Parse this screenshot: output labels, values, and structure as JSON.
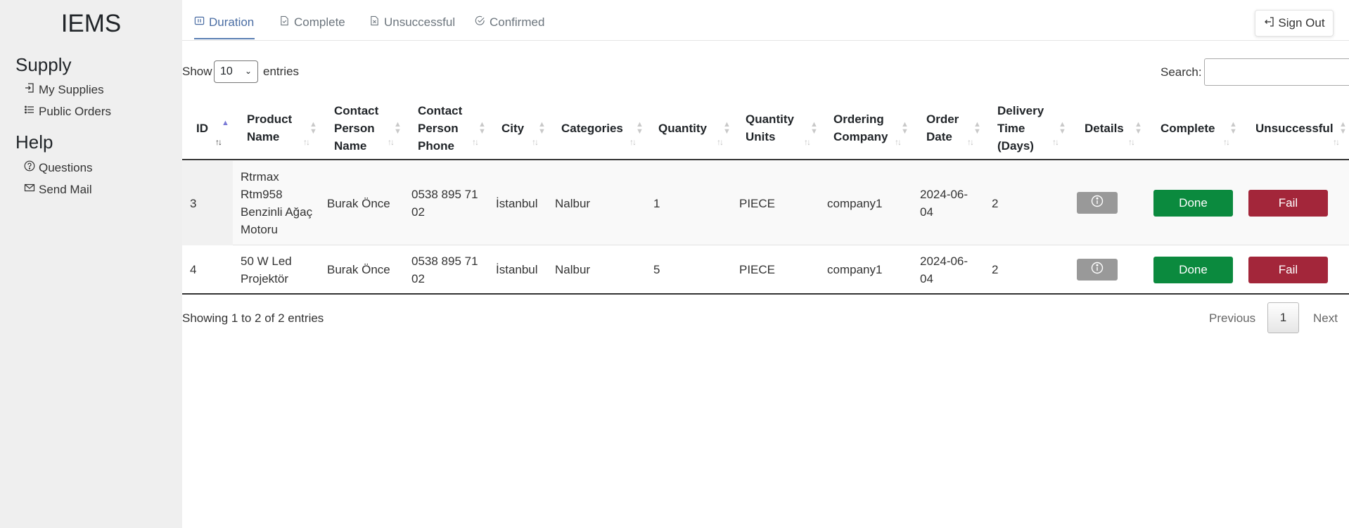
{
  "sidebar": {
    "brand": "IEMS",
    "supply_title": "Supply",
    "supply_items": [
      {
        "label": "My Supplies",
        "icon": "login-icon"
      },
      {
        "label": "Public Orders",
        "icon": "list-icon"
      }
    ],
    "help_title": "Help",
    "help_items": [
      {
        "label": "Questions",
        "icon": "question-circle-icon"
      },
      {
        "label": "Send Mail",
        "icon": "envelope-icon"
      }
    ]
  },
  "tabs": [
    {
      "label": "Duration",
      "icon": "pause-icon",
      "active": true
    },
    {
      "label": "Complete",
      "icon": "file-check-icon"
    },
    {
      "label": "Unsuccessful",
      "icon": "file-x-icon"
    },
    {
      "label": "Confirmed",
      "icon": "check-circle-icon"
    }
  ],
  "sign_out_label": "Sign Out",
  "controls": {
    "show_label": "Show",
    "entries_value": "10",
    "entries_label": "entries",
    "search_label": "Search:",
    "search_value": ""
  },
  "table": {
    "headers": {
      "id": "ID",
      "product_name": [
        "Product",
        "Name"
      ],
      "contact_name": [
        "Contact",
        "Person",
        "Name"
      ],
      "contact_phone": [
        "Contact",
        "Person",
        "Phone"
      ],
      "city": "City",
      "categories": "Categories",
      "quantity": "Quantity",
      "quantity_units": [
        "Quantity",
        "Units"
      ],
      "ordering_company": [
        "Ordering",
        "Company"
      ],
      "order_date": [
        "Order",
        "Date"
      ],
      "delivery_time": [
        "Delivery",
        "Time",
        "(Days)"
      ],
      "details": "Details",
      "complete": "Complete",
      "unsuccessful": "Unsuccessful"
    },
    "rows": [
      {
        "id": "3",
        "product_name": [
          "Rtrmax",
          "Rtm958",
          "Benzinli Ağaç",
          "Motoru"
        ],
        "contact_name": "Burak Önce",
        "contact_phone": [
          "0538 895 71",
          "02"
        ],
        "city": "İstanbul",
        "category": "Nalbur",
        "quantity": "1",
        "unit": "PIECE",
        "company": "company1",
        "order_date": [
          "2024-06-",
          "04"
        ],
        "delivery_days": "2",
        "done_label": "Done",
        "fail_label": "Fail"
      },
      {
        "id": "4",
        "product_name": [
          "50 W Led",
          "Projektör"
        ],
        "contact_name": "Burak Önce",
        "contact_phone": [
          "0538 895 71",
          "02"
        ],
        "city": "İstanbul",
        "category": "Nalbur",
        "quantity": "5",
        "unit": "PIECE",
        "company": "company1",
        "order_date": [
          "2024-06-",
          "04"
        ],
        "delivery_days": "2",
        "done_label": "Done",
        "fail_label": "Fail"
      }
    ]
  },
  "footer": {
    "info": "Showing 1 to 2 of 2 entries",
    "previous": "Previous",
    "current_page": "1",
    "next": "Next"
  },
  "colors": {
    "sidebar_bg": "#efefef",
    "active_tab": "#4a6da3",
    "done": "#0b8a3e",
    "fail": "#a3263a",
    "details_button": "#999999"
  }
}
